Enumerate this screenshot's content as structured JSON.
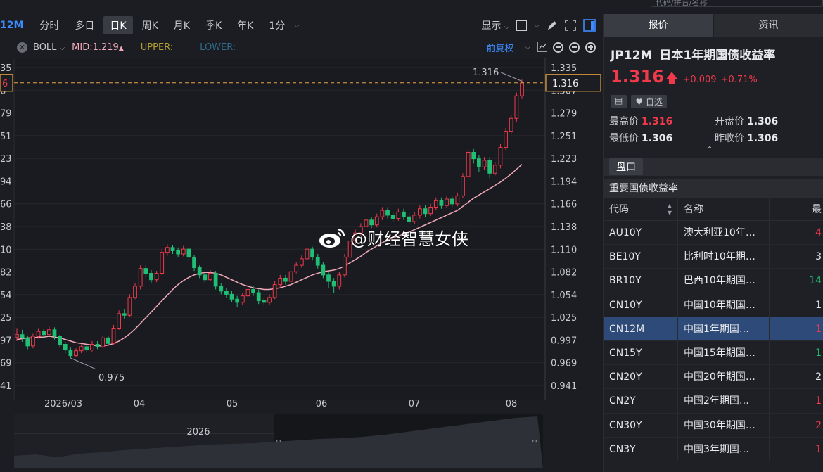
{
  "top": {
    "search_text": "代码/拼音/名称"
  },
  "toolbar": {
    "symbol": "12M",
    "tabs": [
      "分时",
      "多日",
      "日K",
      "周K",
      "月K",
      "季K",
      "年K",
      "1分"
    ],
    "active_tab": "日K",
    "display_label": "显示"
  },
  "indicator": {
    "name": "BOLL",
    "mid": "MID:1.219",
    "upper": "UPPER:",
    "lower": "LOWER:",
    "adjust_label": "前复权"
  },
  "colors": {
    "up": "#f03a4b",
    "down": "#1fbf75",
    "mid_line": "#f2a9b8",
    "accent_blue": "#3d8cff",
    "crosshair": "#e8a33d"
  },
  "chart_data": {
    "type": "candlestick",
    "y_ticks": [
      "1.335",
      "1.307",
      "1.279",
      "1.251",
      "1.223",
      "1.194",
      "1.166",
      "1.138",
      "1.110",
      "1.082",
      "1.054",
      "1.025",
      "0.997",
      "0.969",
      "0.941"
    ],
    "left_ticks": [
      "35",
      "6",
      "79",
      "51",
      "23",
      "94",
      "66",
      "38",
      "10",
      "82",
      "54",
      "25",
      "97",
      "69",
      "41"
    ],
    "ylim": [
      0.941,
      1.335
    ],
    "x_ticks": [
      "2026/03",
      "04",
      "05",
      "06",
      "07",
      "08"
    ],
    "current_price": "1.316",
    "current_value": 1.316,
    "high_label": "1.316",
    "low_label": "0.975",
    "low_value": 0.975,
    "candles": [
      [
        1.001,
        1.004,
        1.012,
        0.996
      ],
      [
        1.004,
        1.0,
        1.01,
        0.995
      ],
      [
        1.0,
        0.99,
        1.003,
        0.986
      ],
      [
        0.99,
        1.002,
        1.005,
        0.987
      ],
      [
        1.002,
        1.008,
        1.012,
        0.999
      ],
      [
        1.008,
        1.004,
        1.011,
        1.0
      ],
      [
        1.004,
        1.01,
        1.014,
        1.002
      ],
      [
        1.01,
        1.002,
        1.013,
        0.998
      ],
      [
        1.002,
        0.992,
        1.004,
        0.988
      ],
      [
        0.992,
        0.985,
        0.995,
        0.981
      ],
      [
        0.985,
        0.978,
        0.988,
        0.975
      ],
      [
        0.978,
        0.984,
        0.987,
        0.976
      ],
      [
        0.984,
        0.989,
        0.992,
        0.981
      ],
      [
        0.989,
        0.985,
        0.992,
        0.982
      ],
      [
        0.985,
        0.992,
        0.996,
        0.983
      ],
      [
        0.992,
        0.989,
        0.996,
        0.986
      ],
      [
        0.989,
        1.0,
        1.003,
        0.987
      ],
      [
        1.0,
        0.993,
        1.003,
        0.99
      ],
      [
        0.993,
        1.012,
        1.016,
        0.991
      ],
      [
        1.012,
        1.03,
        1.034,
        1.01
      ],
      [
        1.03,
        1.028,
        1.036,
        1.024
      ],
      [
        1.028,
        1.05,
        1.054,
        1.026
      ],
      [
        1.05,
        1.064,
        1.068,
        1.048
      ],
      [
        1.064,
        1.086,
        1.09,
        1.06
      ],
      [
        1.086,
        1.08,
        1.09,
        1.075
      ],
      [
        1.08,
        1.072,
        1.084,
        1.068
      ],
      [
        1.072,
        1.08,
        1.083,
        1.069
      ],
      [
        1.08,
        1.106,
        1.11,
        1.078
      ],
      [
        1.106,
        1.112,
        1.116,
        1.102
      ],
      [
        1.112,
        1.108,
        1.115,
        1.104
      ],
      [
        1.108,
        1.104,
        1.112,
        1.1
      ],
      [
        1.104,
        1.11,
        1.114,
        1.101
      ],
      [
        1.11,
        1.1,
        1.113,
        1.096
      ],
      [
        1.1,
        1.087,
        1.103,
        1.083
      ],
      [
        1.087,
        1.078,
        1.09,
        1.074
      ],
      [
        1.078,
        1.072,
        1.082,
        1.068
      ],
      [
        1.072,
        1.08,
        1.084,
        1.07
      ],
      [
        1.08,
        1.064,
        1.083,
        1.06
      ],
      [
        1.064,
        1.058,
        1.068,
        1.054
      ],
      [
        1.058,
        1.054,
        1.062,
        1.05
      ],
      [
        1.054,
        1.048,
        1.058,
        1.044
      ],
      [
        1.048,
        1.044,
        1.052,
        1.038
      ],
      [
        1.044,
        1.052,
        1.056,
        1.041
      ],
      [
        1.052,
        1.06,
        1.064,
        1.049
      ],
      [
        1.06,
        1.056,
        1.064,
        1.052
      ],
      [
        1.056,
        1.046,
        1.06,
        1.042
      ],
      [
        1.046,
        1.044,
        1.05,
        1.04
      ],
      [
        1.044,
        1.05,
        1.054,
        1.041
      ],
      [
        1.05,
        1.066,
        1.07,
        1.048
      ],
      [
        1.066,
        1.074,
        1.078,
        1.063
      ],
      [
        1.074,
        1.07,
        1.078,
        1.066
      ],
      [
        1.07,
        1.082,
        1.086,
        1.068
      ],
      [
        1.082,
        1.09,
        1.094,
        1.08
      ],
      [
        1.09,
        1.098,
        1.102,
        1.087
      ],
      [
        1.098,
        1.11,
        1.114,
        1.095
      ],
      [
        1.11,
        1.1,
        1.113,
        1.096
      ],
      [
        1.1,
        1.09,
        1.104,
        1.086
      ],
      [
        1.09,
        1.078,
        1.094,
        1.074
      ],
      [
        1.078,
        1.07,
        1.082,
        1.062
      ],
      [
        1.07,
        1.064,
        1.074,
        1.056
      ],
      [
        1.064,
        1.078,
        1.082,
        1.06
      ],
      [
        1.078,
        1.1,
        1.104,
        1.075
      ],
      [
        1.1,
        1.12,
        1.124,
        1.098
      ],
      [
        1.12,
        1.13,
        1.134,
        1.116
      ],
      [
        1.13,
        1.138,
        1.142,
        1.126
      ],
      [
        1.138,
        1.146,
        1.15,
        1.134
      ],
      [
        1.146,
        1.14,
        1.15,
        1.136
      ],
      [
        1.14,
        1.15,
        1.154,
        1.137
      ],
      [
        1.15,
        1.158,
        1.162,
        1.146
      ],
      [
        1.158,
        1.152,
        1.162,
        1.148
      ],
      [
        1.152,
        1.148,
        1.156,
        1.144
      ],
      [
        1.148,
        1.156,
        1.16,
        1.145
      ],
      [
        1.156,
        1.15,
        1.16,
        1.146
      ],
      [
        1.15,
        1.144,
        1.154,
        1.14
      ],
      [
        1.144,
        1.152,
        1.156,
        1.141
      ],
      [
        1.152,
        1.16,
        1.164,
        1.148
      ],
      [
        1.16,
        1.154,
        1.164,
        1.15
      ],
      [
        1.154,
        1.162,
        1.166,
        1.151
      ],
      [
        1.162,
        1.17,
        1.174,
        1.158
      ],
      [
        1.17,
        1.164,
        1.174,
        1.16
      ],
      [
        1.164,
        1.172,
        1.176,
        1.161
      ],
      [
        1.172,
        1.166,
        1.176,
        1.162
      ],
      [
        1.166,
        1.176,
        1.18,
        1.163
      ],
      [
        1.176,
        1.2,
        1.204,
        1.173
      ],
      [
        1.2,
        1.23,
        1.234,
        1.197
      ],
      [
        1.23,
        1.222,
        1.234,
        1.216
      ],
      [
        1.222,
        1.212,
        1.226,
        1.206
      ],
      [
        1.212,
        1.22,
        1.224,
        1.208
      ],
      [
        1.22,
        1.204,
        1.224,
        1.198
      ],
      [
        1.204,
        1.214,
        1.218,
        1.201
      ],
      [
        1.214,
        1.236,
        1.24,
        1.21
      ],
      [
        1.236,
        1.256,
        1.26,
        1.233
      ],
      [
        1.256,
        1.272,
        1.276,
        1.252
      ],
      [
        1.272,
        1.3,
        1.304,
        1.268
      ],
      [
        1.3,
        1.316,
        1.32,
        1.296
      ]
    ],
    "mid_line": [
      0.998,
      0.999,
      1.0,
      1.0,
      1.001,
      1.001,
      1.002,
      1.001,
      1.0,
      0.998,
      0.996,
      0.994,
      0.993,
      0.992,
      0.991,
      0.99,
      0.99,
      0.991,
      0.993,
      0.996,
      1.0,
      1.005,
      1.011,
      1.018,
      1.025,
      1.032,
      1.039,
      1.046,
      1.053,
      1.06,
      1.066,
      1.071,
      1.075,
      1.078,
      1.08,
      1.081,
      1.081,
      1.08,
      1.078,
      1.075,
      1.072,
      1.069,
      1.066,
      1.064,
      1.062,
      1.061,
      1.06,
      1.06,
      1.061,
      1.062,
      1.064,
      1.066,
      1.069,
      1.072,
      1.075,
      1.078,
      1.08,
      1.082,
      1.083,
      1.084,
      1.086,
      1.089,
      1.093,
      1.097,
      1.101,
      1.106,
      1.11,
      1.114,
      1.118,
      1.121,
      1.124,
      1.126,
      1.129,
      1.131,
      1.134,
      1.137,
      1.14,
      1.143,
      1.146,
      1.149,
      1.152,
      1.155,
      1.158,
      1.163,
      1.168,
      1.173,
      1.177,
      1.181,
      1.185,
      1.189,
      1.193,
      1.198,
      1.203,
      1.209,
      1.215
    ]
  },
  "navigator": {
    "year_label": "2026"
  },
  "watermark": {
    "text": "@财经智慧女侠"
  },
  "panel": {
    "tabs": [
      "报价",
      "资讯"
    ],
    "code": "JP12M",
    "name": "日本1年期国债收益率",
    "price": "1.316",
    "change": "+0.009",
    "change_pct": "+0.71%",
    "favorite": "自选",
    "stats": [
      {
        "label": "最高价",
        "value": "1.316",
        "red": true
      },
      {
        "label": "开盘价",
        "value": "1.306",
        "red": false
      },
      {
        "label": "最低价",
        "value": "1.306",
        "red": false
      },
      {
        "label": "昨收价",
        "value": "1.306",
        "red": false
      }
    ],
    "pankou": "盘口",
    "section_title": "重要国债收益率",
    "headers": [
      "代码",
      "名称",
      "最"
    ],
    "rows": [
      {
        "code": "AU10Y",
        "name": "澳大利亚10年…",
        "val": "4",
        "color": "red",
        "sel": false
      },
      {
        "code": "BE10Y",
        "name": "比利时10年期…",
        "val": "3",
        "color": "white",
        "sel": false
      },
      {
        "code": "BR10Y",
        "name": "巴西10年期国…",
        "val": "14",
        "color": "green",
        "sel": false
      },
      {
        "code": "CN10Y",
        "name": "中国10年期国…",
        "val": "1",
        "color": "white",
        "sel": false
      },
      {
        "code": "CN12M",
        "name": "中国1年期国…",
        "val": "1",
        "color": "red",
        "sel": true
      },
      {
        "code": "CN15Y",
        "name": "中国15年期国…",
        "val": "1",
        "color": "green",
        "sel": false
      },
      {
        "code": "CN20Y",
        "name": "中国20年期国…",
        "val": "2",
        "color": "white",
        "sel": false
      },
      {
        "code": "CN2Y",
        "name": "中国2年期国…",
        "val": "1",
        "color": "red",
        "sel": false
      },
      {
        "code": "CN30Y",
        "name": "中国30年期国…",
        "val": "2",
        "color": "red",
        "sel": false
      },
      {
        "code": "CN3Y",
        "name": "中国3年期国…",
        "val": "1",
        "color": "red",
        "sel": false
      }
    ]
  }
}
